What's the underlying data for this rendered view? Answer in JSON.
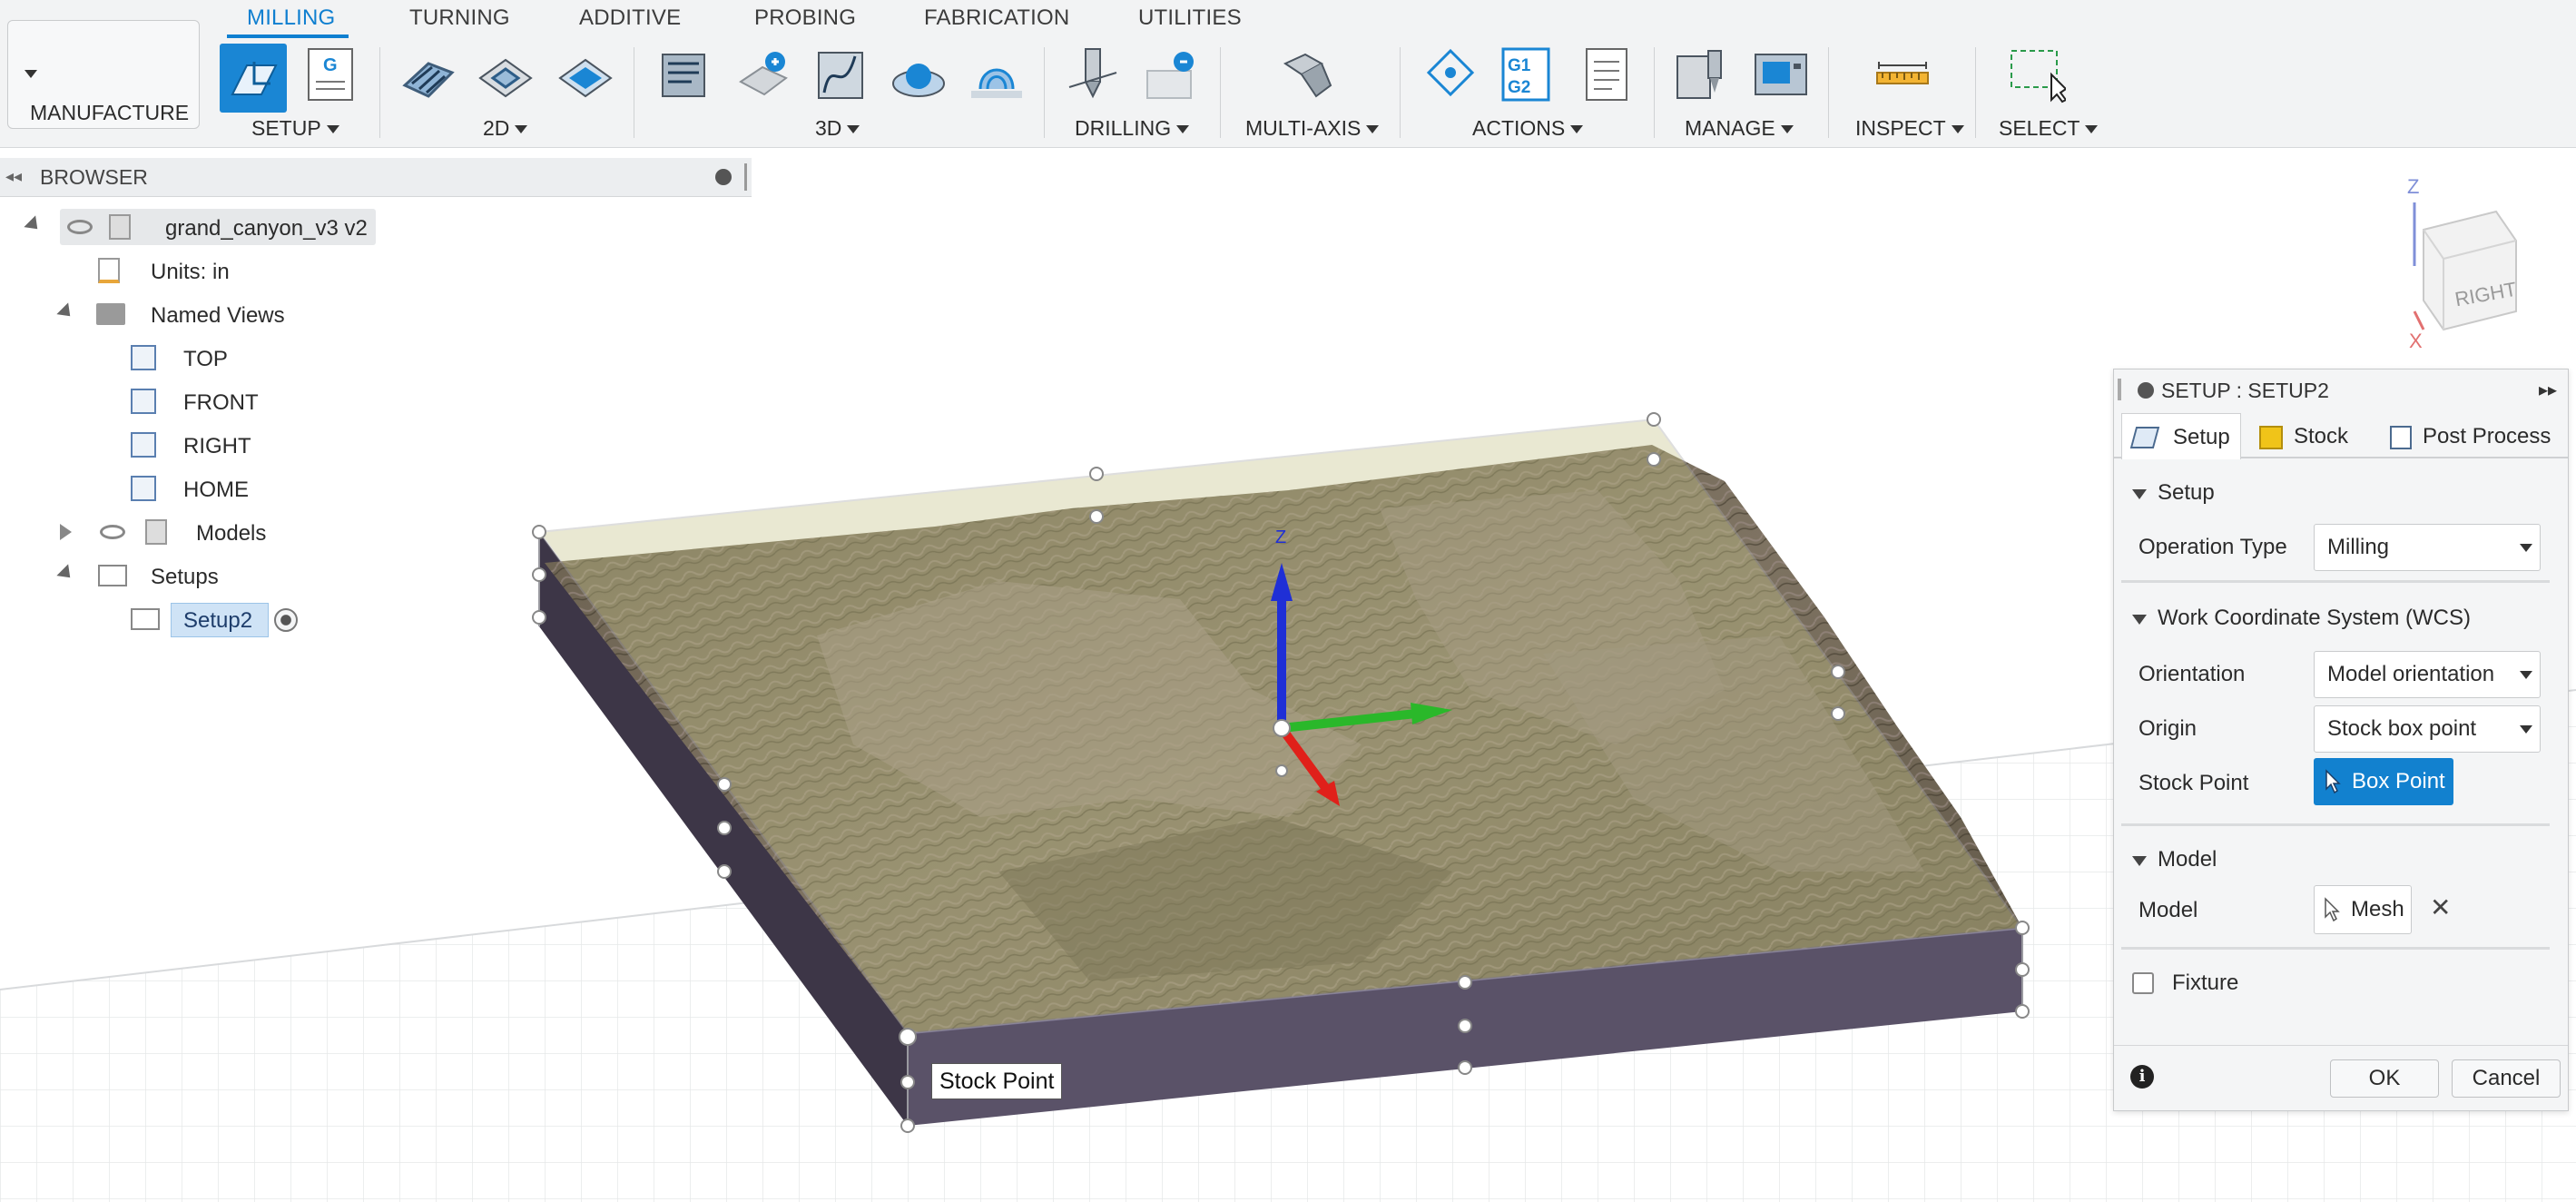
{
  "toolbar": {
    "workspace": "MANUFACTURE",
    "tabs": [
      "MILLING",
      "TURNING",
      "ADDITIVE",
      "PROBING",
      "FABRICATION",
      "UTILITIES"
    ],
    "groups": [
      "SETUP",
      "2D",
      "3D",
      "DRILLING",
      "MULTI-AXIS",
      "ACTIONS",
      "MANAGE",
      "INSPECT",
      "SELECT"
    ],
    "g1g2_icon_text": "G1 G2",
    "g_icon_text": "G"
  },
  "browser": {
    "title": "BROWSER",
    "root": "grand_canyon_v3 v2",
    "units": "Units: in",
    "named_views": "Named Views",
    "views": [
      "TOP",
      "FRONT",
      "RIGHT",
      "HOME"
    ],
    "models": "Models",
    "setups": "Setups",
    "setup_item": "Setup2"
  },
  "viewport": {
    "tooltip": "Stock Point",
    "viewcube_face": "RIGHT",
    "axis_z": "Z",
    "axis_x": "X"
  },
  "dialog": {
    "title": "SETUP : SETUP2",
    "tabs": [
      "Setup",
      "Stock",
      "Post Process"
    ],
    "section_setup": "Setup",
    "operation_type_label": "Operation Type",
    "operation_type_value": "Milling",
    "section_wcs": "Work Coordinate System (WCS)",
    "orientation_label": "Orientation",
    "orientation_value": "Model orientation",
    "origin_label": "Origin",
    "origin_value": "Stock box point",
    "stock_point_label": "Stock Point",
    "stock_point_button": "Box Point",
    "section_model": "Model",
    "model_label": "Model",
    "model_button": "Mesh",
    "fixture_label": "Fixture",
    "fixture_checked": false,
    "ok": "OK",
    "cancel": "Cancel"
  },
  "colors": {
    "accent": "#0f7fd0",
    "stock_point_button_bg": "#1281cf",
    "terrain_dark": "#5a5142",
    "terrain_light": "#8d7f7c",
    "stock_tint": "#c6c48a",
    "stock_sides": "#4b4457"
  }
}
